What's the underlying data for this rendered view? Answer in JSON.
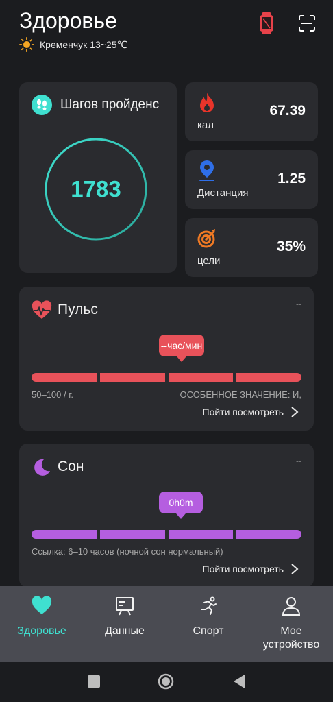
{
  "header": {
    "title": "Здоровье",
    "weather_text": "Кременчук 13~25℃"
  },
  "steps": {
    "title": "Шагов пройденс",
    "value": "1783"
  },
  "calories": {
    "label": "кал",
    "value": "67.39"
  },
  "distance": {
    "label": "Дистанция",
    "value": "1.25"
  },
  "goal": {
    "label": "цели",
    "value": "35%"
  },
  "pulse": {
    "title": "Пульс",
    "dashes": "--",
    "bubble": "--час/мин",
    "note_left": "50–100 / г.",
    "note_right": "ОСОБЕННОЕ ЗНАЧЕНИЕ: И,",
    "link": "Пойти посмотреть"
  },
  "sleep": {
    "title": "Сон",
    "dashes": "--",
    "bubble": "0h0m",
    "note": "Ссылка: 6–10 часов (ночной сон нормальный)",
    "link": "Пойти посмотреть"
  },
  "tabs": [
    {
      "label": "Здоровье",
      "icon": "heart-icon"
    },
    {
      "label": "Данные",
      "icon": "chart-board-icon"
    },
    {
      "label": "Спорт",
      "icon": "runner-icon"
    },
    {
      "label": "Мое устройство",
      "icon": "person-icon"
    }
  ],
  "colors": {
    "accent": "#3fe0d0",
    "pulse": "#e8525a",
    "sleep": "#b55ee0",
    "card": "#2a2b2f",
    "background": "#1b1c1f"
  }
}
